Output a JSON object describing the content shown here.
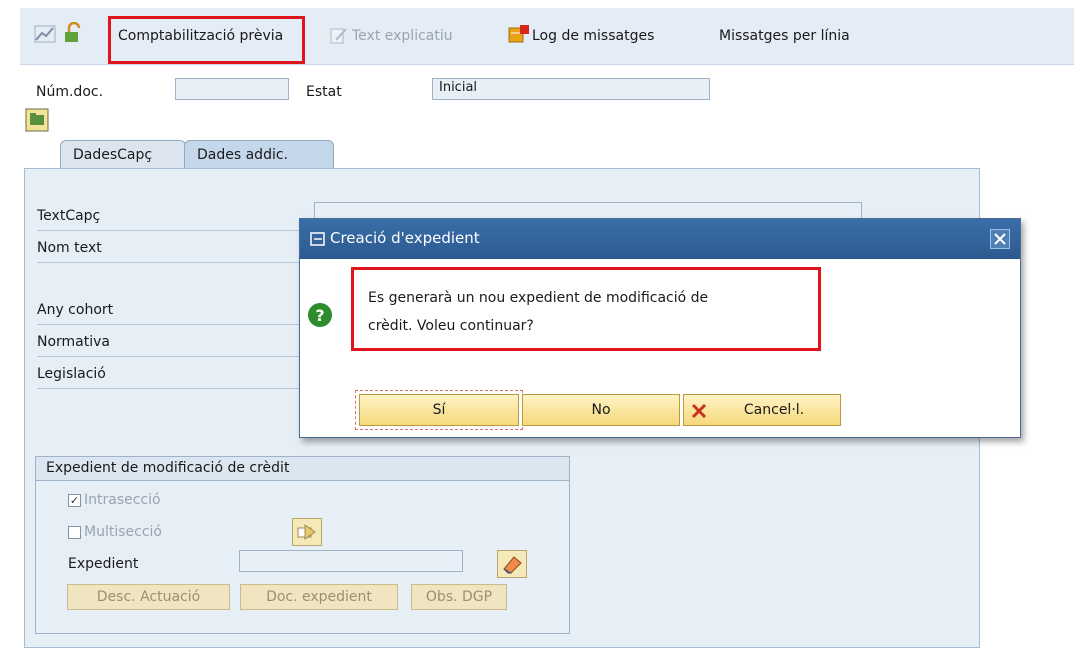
{
  "toolbar": {
    "preview_posting_label": "Comptabilització prèvia",
    "explanatory_text_label": "Text explicatiu",
    "message_log_label": "Log de missatges",
    "messages_per_line_label": "Missatges per línia"
  },
  "header": {
    "doc_number_label": "Núm.doc.",
    "doc_number_value": "",
    "status_label": "Estat",
    "status_value": "Inicial"
  },
  "tabs": [
    {
      "label": "DadesCapç",
      "active": false
    },
    {
      "label": "Dades addic.",
      "active": true
    }
  ],
  "panel": {
    "fields": [
      {
        "label": "TextCapç"
      },
      {
        "label": "Nom text"
      },
      {
        "label": "Any cohort"
      },
      {
        "label": "Normativa"
      },
      {
        "label": "Legislació"
      }
    ],
    "group": {
      "title": "Expedient de modificació de crèdit",
      "intrasection_label": "Intrasecció",
      "intrasection_checked": true,
      "multisection_label": "Multisecció",
      "multisection_checked": false,
      "expedient_label": "Expedient",
      "expedient_value": "",
      "buttons": [
        "Desc. Actuació",
        "Doc. expedient",
        "Obs. DGP"
      ]
    }
  },
  "dialog": {
    "title": "Creació d'expedient",
    "message_line1": "Es generarà un nou expedient de modificació de",
    "message_line2": "crèdit. Voleu continuar?",
    "yes_label": "Sí",
    "no_label": "No",
    "cancel_label": "Cancel·l."
  },
  "colors": {
    "highlight_red": "#e0141b",
    "dialog_title_blue": "#2c5a90",
    "button_yellow": "#f5d97a",
    "question_green": "#2e8b2e"
  }
}
